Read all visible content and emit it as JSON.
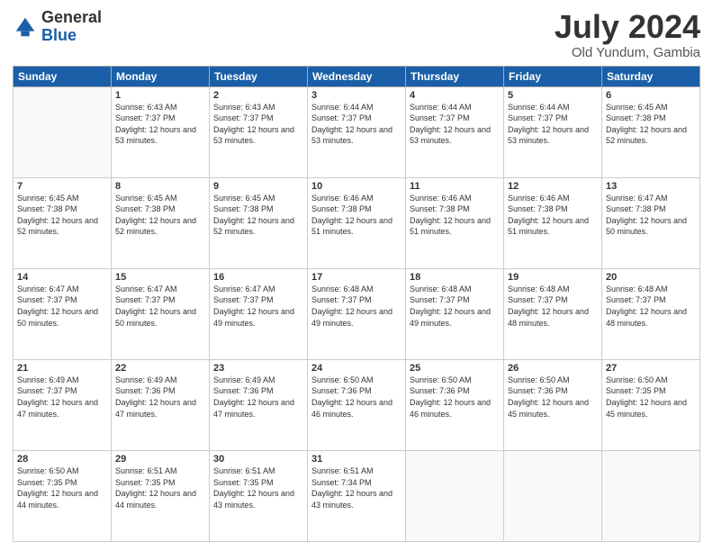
{
  "header": {
    "logo_general": "General",
    "logo_blue": "Blue",
    "month_title": "July 2024",
    "location": "Old Yundum, Gambia"
  },
  "days_of_week": [
    "Sunday",
    "Monday",
    "Tuesday",
    "Wednesday",
    "Thursday",
    "Friday",
    "Saturday"
  ],
  "weeks": [
    [
      {
        "day": "",
        "sunrise": "",
        "sunset": "",
        "daylight": ""
      },
      {
        "day": "1",
        "sunrise": "Sunrise: 6:43 AM",
        "sunset": "Sunset: 7:37 PM",
        "daylight": "Daylight: 12 hours and 53 minutes."
      },
      {
        "day": "2",
        "sunrise": "Sunrise: 6:43 AM",
        "sunset": "Sunset: 7:37 PM",
        "daylight": "Daylight: 12 hours and 53 minutes."
      },
      {
        "day": "3",
        "sunrise": "Sunrise: 6:44 AM",
        "sunset": "Sunset: 7:37 PM",
        "daylight": "Daylight: 12 hours and 53 minutes."
      },
      {
        "day": "4",
        "sunrise": "Sunrise: 6:44 AM",
        "sunset": "Sunset: 7:37 PM",
        "daylight": "Daylight: 12 hours and 53 minutes."
      },
      {
        "day": "5",
        "sunrise": "Sunrise: 6:44 AM",
        "sunset": "Sunset: 7:37 PM",
        "daylight": "Daylight: 12 hours and 53 minutes."
      },
      {
        "day": "6",
        "sunrise": "Sunrise: 6:45 AM",
        "sunset": "Sunset: 7:38 PM",
        "daylight": "Daylight: 12 hours and 52 minutes."
      }
    ],
    [
      {
        "day": "7",
        "sunrise": "Sunrise: 6:45 AM",
        "sunset": "Sunset: 7:38 PM",
        "daylight": "Daylight: 12 hours and 52 minutes."
      },
      {
        "day": "8",
        "sunrise": "Sunrise: 6:45 AM",
        "sunset": "Sunset: 7:38 PM",
        "daylight": "Daylight: 12 hours and 52 minutes."
      },
      {
        "day": "9",
        "sunrise": "Sunrise: 6:45 AM",
        "sunset": "Sunset: 7:38 PM",
        "daylight": "Daylight: 12 hours and 52 minutes."
      },
      {
        "day": "10",
        "sunrise": "Sunrise: 6:46 AM",
        "sunset": "Sunset: 7:38 PM",
        "daylight": "Daylight: 12 hours and 51 minutes."
      },
      {
        "day": "11",
        "sunrise": "Sunrise: 6:46 AM",
        "sunset": "Sunset: 7:38 PM",
        "daylight": "Daylight: 12 hours and 51 minutes."
      },
      {
        "day": "12",
        "sunrise": "Sunrise: 6:46 AM",
        "sunset": "Sunset: 7:38 PM",
        "daylight": "Daylight: 12 hours and 51 minutes."
      },
      {
        "day": "13",
        "sunrise": "Sunrise: 6:47 AM",
        "sunset": "Sunset: 7:38 PM",
        "daylight": "Daylight: 12 hours and 50 minutes."
      }
    ],
    [
      {
        "day": "14",
        "sunrise": "Sunrise: 6:47 AM",
        "sunset": "Sunset: 7:37 PM",
        "daylight": "Daylight: 12 hours and 50 minutes."
      },
      {
        "day": "15",
        "sunrise": "Sunrise: 6:47 AM",
        "sunset": "Sunset: 7:37 PM",
        "daylight": "Daylight: 12 hours and 50 minutes."
      },
      {
        "day": "16",
        "sunrise": "Sunrise: 6:47 AM",
        "sunset": "Sunset: 7:37 PM",
        "daylight": "Daylight: 12 hours and 49 minutes."
      },
      {
        "day": "17",
        "sunrise": "Sunrise: 6:48 AM",
        "sunset": "Sunset: 7:37 PM",
        "daylight": "Daylight: 12 hours and 49 minutes."
      },
      {
        "day": "18",
        "sunrise": "Sunrise: 6:48 AM",
        "sunset": "Sunset: 7:37 PM",
        "daylight": "Daylight: 12 hours and 49 minutes."
      },
      {
        "day": "19",
        "sunrise": "Sunrise: 6:48 AM",
        "sunset": "Sunset: 7:37 PM",
        "daylight": "Daylight: 12 hours and 48 minutes."
      },
      {
        "day": "20",
        "sunrise": "Sunrise: 6:48 AM",
        "sunset": "Sunset: 7:37 PM",
        "daylight": "Daylight: 12 hours and 48 minutes."
      }
    ],
    [
      {
        "day": "21",
        "sunrise": "Sunrise: 6:49 AM",
        "sunset": "Sunset: 7:37 PM",
        "daylight": "Daylight: 12 hours and 47 minutes."
      },
      {
        "day": "22",
        "sunrise": "Sunrise: 6:49 AM",
        "sunset": "Sunset: 7:36 PM",
        "daylight": "Daylight: 12 hours and 47 minutes."
      },
      {
        "day": "23",
        "sunrise": "Sunrise: 6:49 AM",
        "sunset": "Sunset: 7:36 PM",
        "daylight": "Daylight: 12 hours and 47 minutes."
      },
      {
        "day": "24",
        "sunrise": "Sunrise: 6:50 AM",
        "sunset": "Sunset: 7:36 PM",
        "daylight": "Daylight: 12 hours and 46 minutes."
      },
      {
        "day": "25",
        "sunrise": "Sunrise: 6:50 AM",
        "sunset": "Sunset: 7:36 PM",
        "daylight": "Daylight: 12 hours and 46 minutes."
      },
      {
        "day": "26",
        "sunrise": "Sunrise: 6:50 AM",
        "sunset": "Sunset: 7:36 PM",
        "daylight": "Daylight: 12 hours and 45 minutes."
      },
      {
        "day": "27",
        "sunrise": "Sunrise: 6:50 AM",
        "sunset": "Sunset: 7:35 PM",
        "daylight": "Daylight: 12 hours and 45 minutes."
      }
    ],
    [
      {
        "day": "28",
        "sunrise": "Sunrise: 6:50 AM",
        "sunset": "Sunset: 7:35 PM",
        "daylight": "Daylight: 12 hours and 44 minutes."
      },
      {
        "day": "29",
        "sunrise": "Sunrise: 6:51 AM",
        "sunset": "Sunset: 7:35 PM",
        "daylight": "Daylight: 12 hours and 44 minutes."
      },
      {
        "day": "30",
        "sunrise": "Sunrise: 6:51 AM",
        "sunset": "Sunset: 7:35 PM",
        "daylight": "Daylight: 12 hours and 43 minutes."
      },
      {
        "day": "31",
        "sunrise": "Sunrise: 6:51 AM",
        "sunset": "Sunset: 7:34 PM",
        "daylight": "Daylight: 12 hours and 43 minutes."
      },
      {
        "day": "",
        "sunrise": "",
        "sunset": "",
        "daylight": ""
      },
      {
        "day": "",
        "sunrise": "",
        "sunset": "",
        "daylight": ""
      },
      {
        "day": "",
        "sunrise": "",
        "sunset": "",
        "daylight": ""
      }
    ]
  ]
}
